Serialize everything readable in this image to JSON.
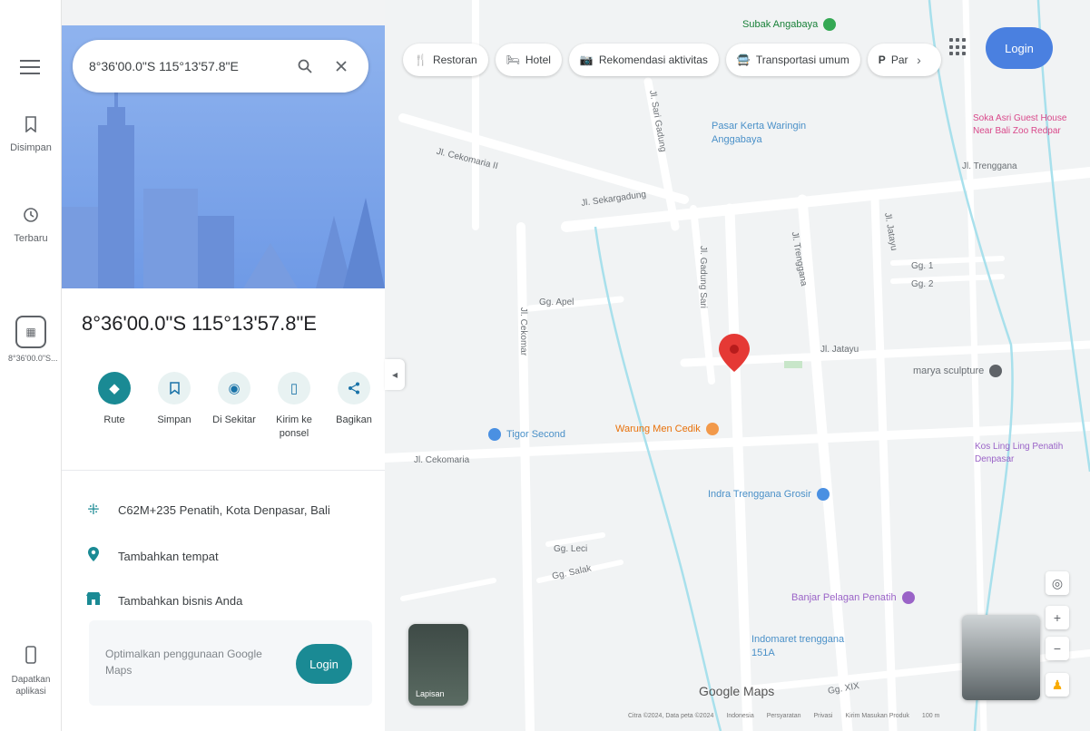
{
  "rail": {
    "saved": "Disimpan",
    "recent": "Terbaru",
    "recent_place": "8°36'00.0\"S...",
    "get_app": "Dapatkan aplikasi"
  },
  "search": {
    "value": "8°36'00.0\"S 115°13'57.8\"E"
  },
  "place": {
    "title": "8°36'00.0\"S 115°13'57.8\"E"
  },
  "actions": [
    {
      "label": "Rute"
    },
    {
      "label": "Simpan"
    },
    {
      "label": "Di Sekitar"
    },
    {
      "label": "Kirim ke ponsel"
    },
    {
      "label": "Bagikan"
    }
  ],
  "info": {
    "plus_code": "C62M+235 Penatih, Kota Denpasar, Bali",
    "add_place": "Tambahkan tempat",
    "add_business": "Tambahkan bisnis Anda"
  },
  "promo": {
    "text": "Optimalkan penggunaan Google Maps",
    "button": "Login"
  },
  "chips": [
    {
      "icon": "fork-knife-icon",
      "glyph": "🍴",
      "label": "Restoran"
    },
    {
      "icon": "bed-icon",
      "glyph": "🛏",
      "label": "Hotel"
    },
    {
      "icon": "camera-icon",
      "glyph": "📷",
      "label": "Rekomendasi aktivitas"
    },
    {
      "icon": "bus-icon",
      "glyph": "🚍",
      "label": "Transportasi umum"
    },
    {
      "icon": "parking-icon",
      "glyph": "P",
      "label": "Par"
    }
  ],
  "header": {
    "login": "Login"
  },
  "map": {
    "streets": {
      "cekomaria_ii": "Jl. Cekomaria II",
      "sekargadung": "Jl. Sekargadung",
      "sari_gadung": "Jl. Sari Gadung",
      "gadung_sari": "Jl. Gadung Sari",
      "trenggana_top": "Jl. Trenggana",
      "trenggana_mid": "Jl. Trenggana",
      "jatayu": "Jl. Jatayu",
      "jatayu_v": "Jl. Jatayu",
      "gg_apel": "Gg. Apel",
      "cekomar": "Jl. Cekomar",
      "cekomaria": "Jl. Cekomaria",
      "gg_salak": "Gg. Salak",
      "gg_leci": "Gg. Leci",
      "gg1": "Gg. 1",
      "gg2": "Gg. 2",
      "ggxix": "Gg. XIX"
    },
    "pois": {
      "subak": "Subak Angabaya",
      "pasar": "Pasar Kerta Waringin Anggabaya",
      "soka": "Soka Asri Guest House Near Bali Zoo Redpar",
      "tigor": "Tigor Second",
      "warung": "Warung Men Cedik",
      "marya": "marya sculpture",
      "kos": "Kos Ling Ling Penatih Denpasar",
      "indra": "Indra Trenggana Grosir",
      "banjar": "Banjar Pelagan Penatih",
      "indomaret": "Indomaret trenggana 151A"
    },
    "layers": "Lapisan",
    "brand": "Google Maps",
    "footer": [
      "Citra ©2024, Data peta ©2024",
      "Indonesia",
      "Persyaratan",
      "Privasi",
      "Kirim Masukan Produk",
      "100 m"
    ]
  },
  "colors": {
    "teal": "#1a8a94",
    "blue": "#4a80e0",
    "pin": "#e53935"
  }
}
